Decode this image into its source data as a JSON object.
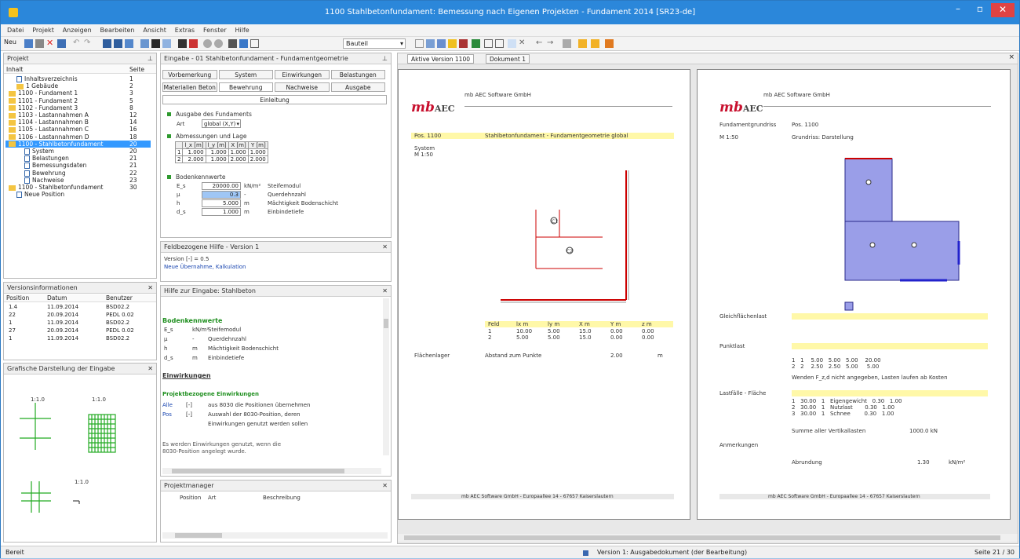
{
  "window": {
    "title": "1100 Stahlbetonfundament: Bemessung nach Eigenen Projekten - Fundament 2014 [SR23-de]"
  },
  "menu": [
    "Datei",
    "Projekt",
    "Anzeigen",
    "Bearbeiten",
    "Ansicht",
    "Extras",
    "Fenster",
    "Hilfe"
  ],
  "toolbar": {
    "new_label": "Neu",
    "combo_value": "Bauteil"
  },
  "project_tree": {
    "header": "Projekt",
    "col_name": "Inhalt",
    "col_page": "Seite",
    "items": [
      {
        "label": "Inhaltsverzeichnis",
        "page": "1",
        "indent": 1,
        "type": "doc"
      },
      {
        "label": "1 Gebäude",
        "page": "2",
        "indent": 1,
        "type": "fold"
      },
      {
        "label": "1100 - Fundament 1",
        "page": "3",
        "indent": 0,
        "type": "fold"
      },
      {
        "label": "1101 - Fundament 2",
        "page": "5",
        "indent": 0,
        "type": "fold"
      },
      {
        "label": "1102 - Fundament 3",
        "page": "8",
        "indent": 0,
        "type": "fold"
      },
      {
        "label": "1103 - Lastannahmen A",
        "page": "12",
        "indent": 0,
        "type": "fold"
      },
      {
        "label": "1104 - Lastannahmen B",
        "page": "14",
        "indent": 0,
        "type": "fold"
      },
      {
        "label": "1105 - Lastannahmen C",
        "page": "16",
        "indent": 0,
        "type": "fold"
      },
      {
        "label": "1106 - Lastannahmen D",
        "page": "18",
        "indent": 0,
        "type": "fold"
      },
      {
        "label": "1100 - Stahlbetonfundament",
        "page": "20",
        "indent": 0,
        "type": "fold",
        "selected": true
      },
      {
        "label": "System",
        "page": "20",
        "indent": 2,
        "type": "doc"
      },
      {
        "label": "Belastungen",
        "page": "21",
        "indent": 2,
        "type": "doc"
      },
      {
        "label": "Bemessungsdaten",
        "page": "21",
        "indent": 2,
        "type": "doc"
      },
      {
        "label": "Bewehrung",
        "page": "22",
        "indent": 2,
        "type": "doc"
      },
      {
        "label": "Nachweise",
        "page": "23",
        "indent": 2,
        "type": "doc"
      },
      {
        "label": "1100 - Stahlbetonfundament",
        "page": "30",
        "indent": 0,
        "type": "fold"
      },
      {
        "label": "Neue Position",
        "page": "",
        "indent": 1,
        "type": "doc"
      }
    ]
  },
  "versions": {
    "header": "Versionsinformationen",
    "cols": [
      "Position",
      "Datum",
      "Benutzer"
    ],
    "rows": [
      [
        "1.4",
        "11.09.2014",
        "BSD02.2"
      ],
      [
        "22",
        "20.09.2014",
        "PEDL 0.02"
      ],
      [
        "1",
        "11.09.2014",
        "BSD02.2"
      ],
      [
        "27",
        "20.09.2014",
        "PEDL 0.02"
      ],
      [
        "1",
        "11.09.2014",
        "BSD02.2"
      ]
    ]
  },
  "graphic_panel": {
    "header": "Grafische Darstellung der Eingabe",
    "label1": "1:1.0",
    "label2": "1:1.0",
    "label3": "1:1.0"
  },
  "input_panel": {
    "header": "Eingabe - 01 Stahlbetonfundament - Fundamentgeometrie",
    "tabs_row1": [
      "Vorbemerkung",
      "System",
      "Einwirkungen",
      "Belastungen"
    ],
    "tabs_row2": [
      "Materialien Beton",
      "Bewehrung",
      "Nachweise",
      "Ausgabe"
    ],
    "tab_active": "Bewehrung",
    "s1": "Ausgabe des Fundaments",
    "s1_field_label": "Art",
    "s1_field_value": "global (X,Y)",
    "s2": "Abmessungen und Lage",
    "grid_head": [
      "",
      "l_x [m]",
      "l_y [m]",
      "X [m]",
      "Y [m]"
    ],
    "grid_rows": [
      [
        "1",
        "1.000",
        "1.000",
        "1.000",
        "1.000"
      ],
      [
        "2",
        "2.000",
        "1.000",
        "2.000",
        "2.000"
      ]
    ],
    "s3": "Bodenkennwerte",
    "params": [
      {
        "sym": "E_s",
        "val": "20000.00",
        "unit": "kN/m²",
        "desc": "Steifemodul"
      },
      {
        "sym": "μ",
        "val": "0.3",
        "unit": "-",
        "desc": "Querdehnzahl"
      },
      {
        "sym": "h",
        "val": "5.000",
        "unit": "m",
        "desc": "Mächtigkeit Bodenschicht"
      },
      {
        "sym": "d_s",
        "val": "1.000",
        "unit": "m",
        "desc": "Einbindetiefe"
      }
    ]
  },
  "field_help": {
    "header": "Feldbezogene Hilfe - Version 1",
    "line1": "Version [-] = 0.5",
    "line2": "Neue Übernahme, Kalkulation"
  },
  "help_panel": {
    "header": "Hilfe zur Eingabe: Stahlbeton",
    "h_boden": "Bodenkennwerte",
    "rows": [
      [
        "E_s",
        "kN/m²",
        "Steifemodul"
      ],
      [
        "μ",
        "-",
        "Querdehnzahl"
      ],
      [
        "h",
        "m",
        "Mächtigkeit Bodenschicht"
      ],
      [
        "d_s",
        "m",
        "Einbindetiefe"
      ]
    ],
    "h_einw": "Einwirkungen",
    "h_proj": "Projektbezogene Einwirkungen",
    "p1_key": "Alle",
    "p1_text": "aus 8030 die Positionen übernehmen",
    "p2_key": "Pos",
    "p2_text": "Auswahl der 8030-Position, deren",
    "p2_text2": "Einwirkungen genutzt werden sollen",
    "note1": "Es werden Einwirkungen genutzt, wenn die",
    "note2": "8030-Position angelegt wurde."
  },
  "bottom_panel": {
    "header": "Projektmanager",
    "cols": [
      "Position",
      "Art",
      "Beschreibung"
    ]
  },
  "doc_tabs": [
    "Aktive Version 1100",
    "Dokument 1"
  ],
  "page1": {
    "company": "mb AEC Software GmbH",
    "pos": "Pos. 1100",
    "heading": "Stahlbetonfundament - Fundamentgeometrie global",
    "sys_label": "System",
    "m_label": "M 1:50",
    "lbl_c1": "C1",
    "lbl_c2": "C2",
    "table_head": [
      "Feld",
      "lx m",
      "ly m",
      "X m",
      "Y m",
      "z m"
    ],
    "table_rows": [
      [
        "1",
        "10.00",
        "5.00",
        "15.0",
        "0.00",
        "0.00"
      ],
      [
        "2",
        "5.00",
        "5.00",
        "15.0",
        "0.00",
        "0.00"
      ]
    ],
    "flaeche_label": "Flächenlager",
    "abstand": "Abstand zum Punkte",
    "abstand_val": "2.00",
    "abstand_unit": "m",
    "footer": "mb AEC Software GmbH - Europaallee 14 - 67657 Kaiserslautern"
  },
  "page2": {
    "company": "mb AEC Software GmbH",
    "pos": "Pos. 1100",
    "sys_label": "Fundamentgrundriss",
    "sys_val": "Grundriss: Darstellung",
    "m_label": "M 1:50",
    "g_label": "Gleichflächenlast",
    "last_label": "Punktlast",
    "last_note": "Wenden F_z,d nicht angegeben, Lasten laufen ab Kosten",
    "schn_label": "Lastfälle - Fläche",
    "sum_label": "Summe aller Vertikallasten",
    "sum_val": "1000.0 kN",
    "anm_label": "Anmerkungen",
    "anm_val": "Abrundung",
    "anm_num": "1.30",
    "anm_unit": "kN/m²",
    "footer": "mb AEC Software GmbH - Europaallee 14 - 67657 Kaiserslautern"
  },
  "status": {
    "left": "Bereit",
    "middle": "Version 1: Ausgabedokument (der Bearbeitung)",
    "right": "Seite 21 / 30"
  }
}
